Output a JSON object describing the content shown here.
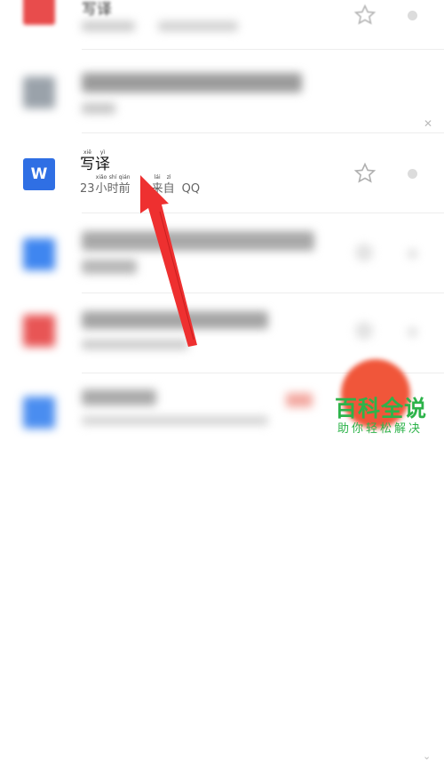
{
  "list": {
    "top_item": {
      "title": "写译",
      "icon_color": "#e84c4c"
    },
    "featured_item": {
      "app_icon_letter": "W",
      "icon_color": "#2f6fe4",
      "title": [
        {
          "hz": "写",
          "py": "xiě"
        },
        {
          "hz": "译",
          "py": "yì"
        }
      ],
      "time_number": "23",
      "time_chars": [
        {
          "hz": "小",
          "py": "xiǎo"
        },
        {
          "hz": "时",
          "py": "shí"
        },
        {
          "hz": "前",
          "py": "qián"
        }
      ],
      "source_chars": [
        {
          "hz": "来",
          "py": "lái"
        },
        {
          "hz": "自",
          "py": "zì"
        }
      ],
      "source_app": "QQ"
    },
    "blurred_icon_colors": [
      "#a9b0b8",
      "#3f86f0",
      "#e85555",
      "#4a8df0"
    ]
  },
  "annotation": {
    "arrow_color": "#ee3030"
  },
  "fab": {
    "color": "#f0563a"
  },
  "watermark": {
    "main": "百科全说",
    "sub": "助你轻松解决",
    "color": "#2db34a"
  }
}
